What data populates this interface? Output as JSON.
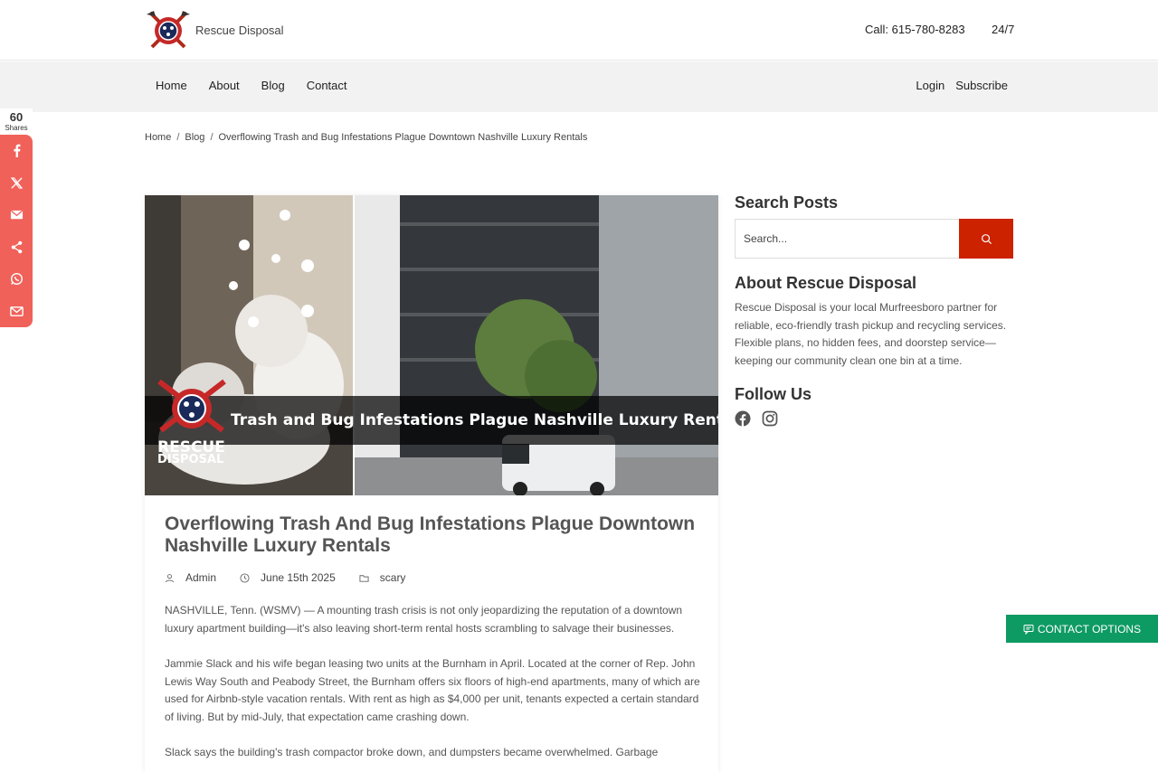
{
  "header": {
    "brand_name": "Rescue Disposal",
    "call": "Call: 615-780-8283",
    "hours": "24/7"
  },
  "nav": {
    "left": [
      "Home",
      "About",
      "Blog",
      "Contact"
    ],
    "right": [
      "Login",
      "Subscribe"
    ]
  },
  "share": {
    "count": "60",
    "label": "Shares",
    "buttons": [
      "facebook-icon",
      "x-icon",
      "email-icon",
      "share-icon",
      "whatsapp-icon",
      "gmail-icon"
    ]
  },
  "breadcrumb": [
    "Home",
    "Blog",
    "Overflowing Trash and Bug Infestations Plague Downtown Nashville Luxury Rentals"
  ],
  "hero": {
    "caption": "Trash and Bug Infestations Plague Nashville Luxury Rentals",
    "logo_line1": "RESCUE",
    "logo_line2": "DISPOSAL"
  },
  "post": {
    "title": "Overflowing Trash And Bug Infestations Plague Downtown Nashville Luxury Rentals",
    "author": "Admin",
    "date": "June 15th 2025",
    "category": "scary",
    "paragraphs": [
      "NASHVILLE, Tenn. (WSMV) — A mounting trash crisis is not only jeopardizing the reputation of a downtown luxury apartment building—it's also leaving short-term rental hosts scrambling to salvage their businesses.",
      "Jammie Slack and his wife began leasing two units at the Burnham in April. Located at the corner of Rep. John Lewis Way South and Peabody Street, the Burnham offers six floors of high-end apartments, many of which are used for Airbnb-style vacation rentals. With rent as high as $4,000 per unit, tenants expected a certain standard of living. But by mid-July, that expectation came crashing down.",
      "Slack says the building's trash compactor broke down, and dumpsters became overwhelmed. Garbage"
    ]
  },
  "sidebar": {
    "search_title": "Search Posts",
    "search_placeholder": "Search...",
    "about_title": "About Rescue Disposal",
    "about_text": "Rescue Disposal is your local Murfreesboro partner for reliable, eco-friendly trash pickup and recycling services. Flexible plans, no hidden fees, and doorstep service—keeping our community clean one bin at a time.",
    "follow_title": "Follow Us"
  },
  "contact_options": "CONTACT OPTIONS",
  "colors": {
    "share_red": "#f0615a",
    "search_red": "#cc2200",
    "contact_green": "#0e9a63"
  }
}
